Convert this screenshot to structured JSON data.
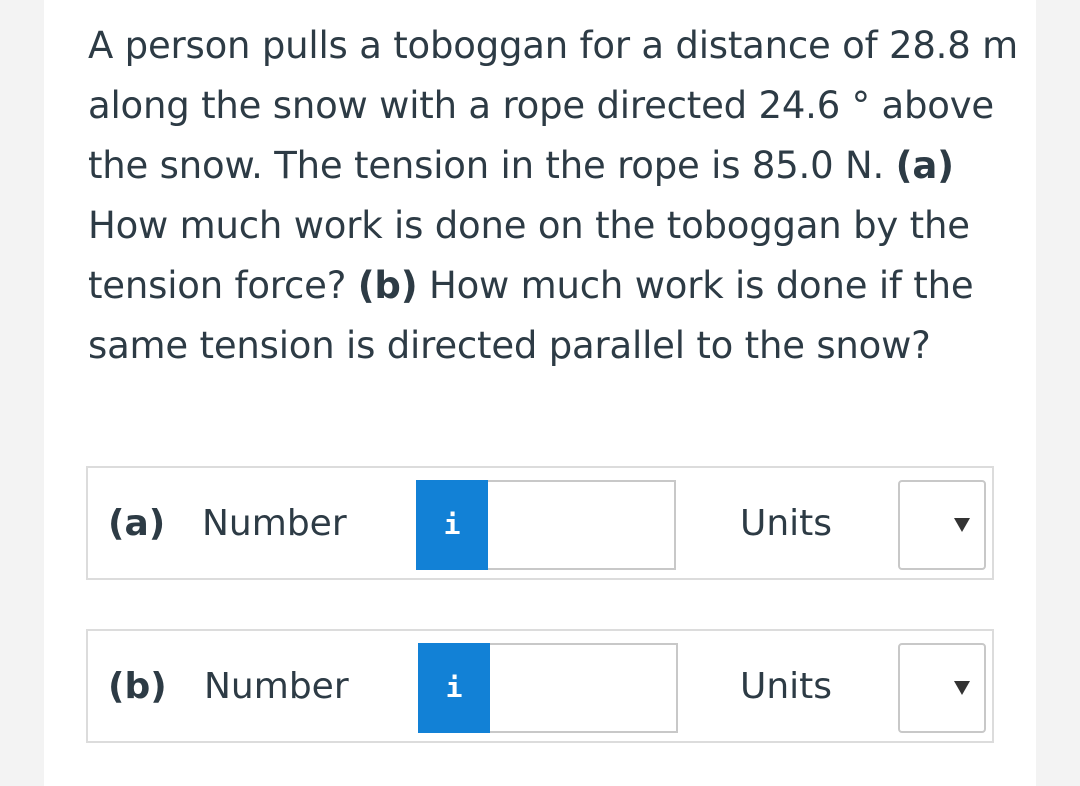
{
  "question": {
    "t1": "A person pulls a toboggan for a distance of 28.8 m along the snow with a rope directed 24.6 ° above the snow. The tension in the rope is 85.0 N. ",
    "a_label": "(a)",
    "t2": " How much work is done on the toboggan by the tension force? ",
    "b_label": "(b)",
    "t3": " How much work is done if the same tension is directed parallel to the snow?"
  },
  "answers": [
    {
      "part_label": "(a)",
      "number_label": "Number",
      "info_icon": "i",
      "number_value": "",
      "units_label": "Units",
      "units_selected": ""
    },
    {
      "part_label": "(b)",
      "number_label": "Number",
      "info_icon": "i",
      "number_value": "",
      "units_label": "Units",
      "units_selected": ""
    }
  ],
  "colors": {
    "info_button": "#1281d6",
    "text": "#2d3b45",
    "border": "#dcdcdc"
  }
}
